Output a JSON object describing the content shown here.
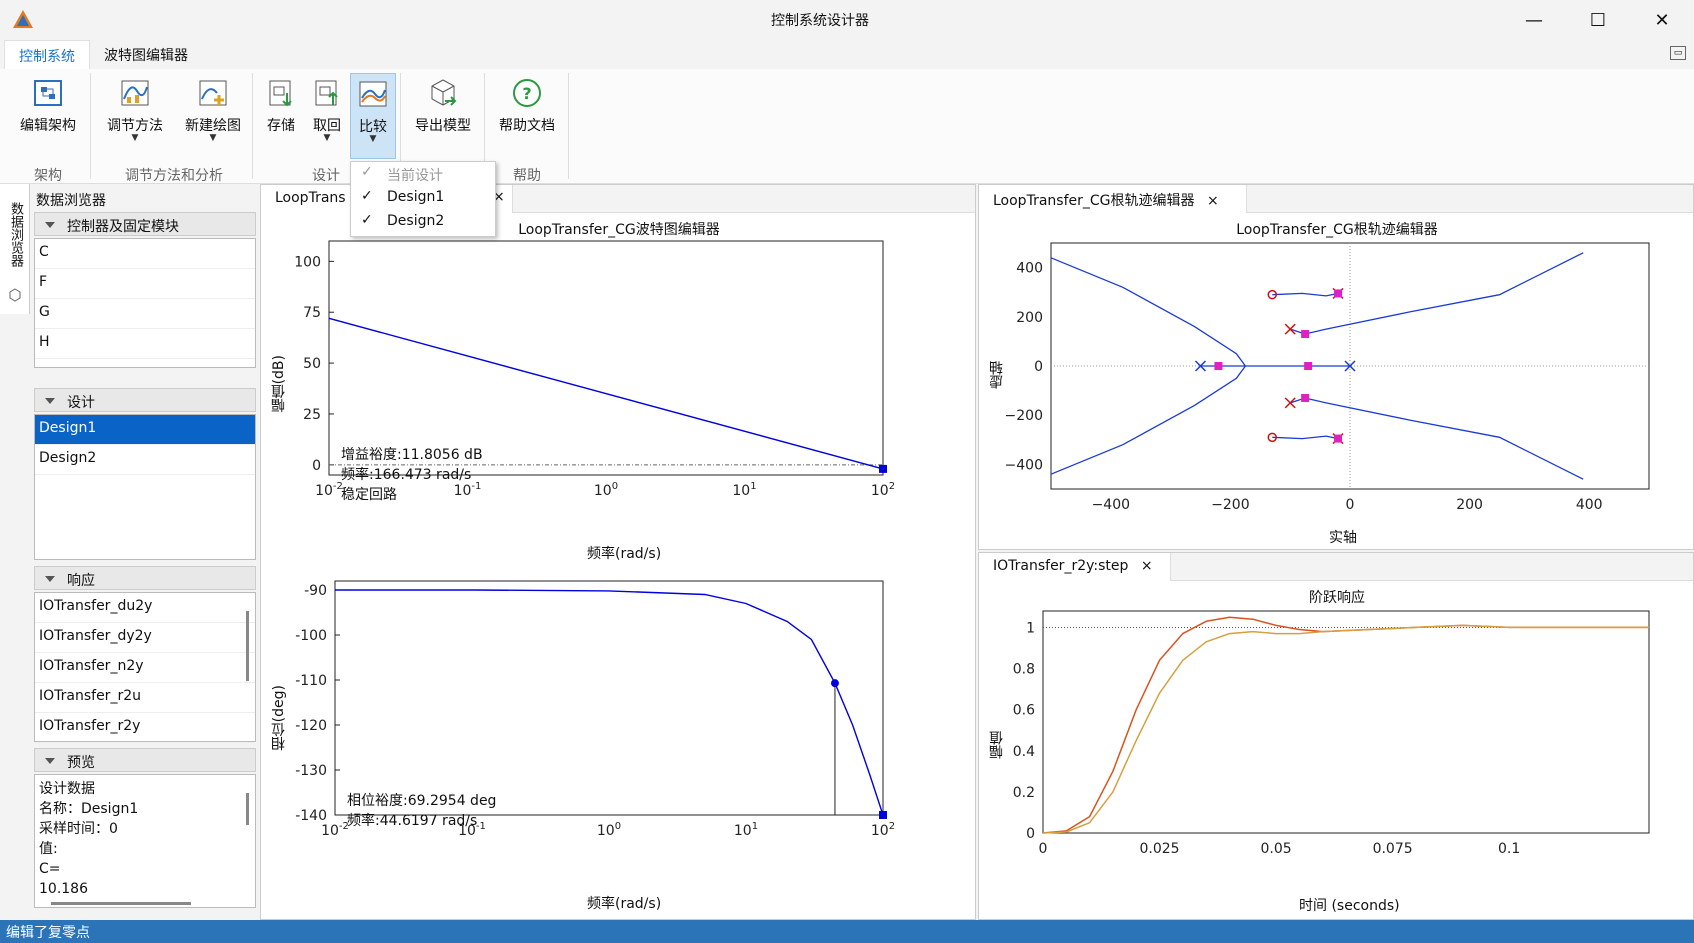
{
  "window": {
    "title": "控制系统设计器"
  },
  "menubar": {
    "tabs": [
      {
        "label": "控制系统"
      },
      {
        "label": "波特图编辑器"
      }
    ]
  },
  "ribbon": {
    "buttons": {
      "edit_arch": "编辑架构",
      "tune": "调节方法",
      "new_plot": "新建绘图",
      "store": "存储",
      "retrieve": "取回",
      "compare": "比较",
      "export": "导出模型",
      "help": "帮助文档"
    },
    "groups": {
      "arch": "架构",
      "tune": "调节方法和分析",
      "design": "设计",
      "help": "帮助"
    }
  },
  "compare_menu": {
    "items": [
      {
        "label": "当前设计",
        "checked": true,
        "disabled": true
      },
      {
        "label": "Design1",
        "checked": true,
        "disabled": false
      },
      {
        "label": "Design2",
        "checked": true,
        "disabled": false
      }
    ]
  },
  "left_strip": {
    "label": "数据浏览器"
  },
  "browser": {
    "title": "数据浏览器",
    "sections": {
      "controllers": "控制器及固定模块",
      "designs": "设计",
      "responses": "响应",
      "preview": "预览"
    },
    "controllers": [
      "C",
      "F",
      "G",
      "H"
    ],
    "designs": [
      "Design1",
      "Design2"
    ],
    "responses": [
      "IOTransfer_du2y",
      "IOTransfer_dy2y",
      "IOTransfer_n2y",
      "IOTransfer_r2u",
      "IOTransfer_r2y"
    ],
    "preview_lines": [
      "设计数据",
      "名称：Design1",
      "采样时间：0",
      "值:",
      "C=",
      "10.186"
    ]
  },
  "bode": {
    "tab": "LoopTransfer_CG波特图编辑器",
    "tab_partial": "LoopTrans",
    "title": "LoopTransfer_CG波特图编辑器",
    "mag_ylabel": "幅值(dB)",
    "phase_ylabel": "相位(deg)",
    "xlabel": "频率(rad/s)",
    "mag_ann": [
      "增益裕度:11.8056 dB",
      "频率:166.473 rad/s",
      "稳定回路"
    ],
    "phase_ann": [
      "相位裕度:69.2954 deg",
      "频率:44.6197 rad/s"
    ]
  },
  "rlocus": {
    "tab": "LoopTransfer_CG根轨迹编辑器",
    "title": "LoopTransfer_CG根轨迹编辑器",
    "xlabel": "实轴",
    "ylabel": "虚轴"
  },
  "step": {
    "tab": "IOTransfer_r2y:step",
    "title": "阶跃响应",
    "xlabel": "时间 (seconds)",
    "ylabel": "幅值"
  },
  "statusbar": {
    "text": "编辑了复零点"
  },
  "chart_data": [
    {
      "type": "line",
      "name": "bode-magnitude",
      "xscale": "log",
      "x": [
        0.01,
        100
      ],
      "values": [
        72,
        -2
      ],
      "xlim": [
        0.01,
        100
      ],
      "ylim": [
        -5,
        110
      ],
      "yticks": [
        0,
        25,
        50,
        75,
        100
      ],
      "xtick_labels": [
        "10-2",
        "10-1",
        "100",
        "101",
        "102"
      ],
      "ylabel": "幅值(dB)",
      "xlabel": "频率(rad/s)",
      "color": "#0000e0"
    },
    {
      "type": "line",
      "name": "bode-phase",
      "xscale": "log",
      "x": [
        0.01,
        0.1,
        1,
        5,
        10,
        20,
        30,
        44.6,
        60,
        80,
        100
      ],
      "values": [
        -90,
        -90,
        -90.2,
        -91,
        -93,
        -97,
        -101,
        -110.7,
        -120,
        -131,
        -140
      ],
      "xlim": [
        0.01,
        100
      ],
      "ylim": [
        -140,
        -88
      ],
      "yticks": [
        -90,
        -100,
        -110,
        -120,
        -130,
        -140
      ],
      "xtick_labels": [
        "10-2",
        "10-1",
        "100",
        "101",
        "102"
      ],
      "ylabel": "相位(deg)",
      "xlabel": "频率(rad/s)",
      "color": "#0000e0"
    },
    {
      "type": "scatter",
      "name": "root-locus",
      "xlim": [
        -500,
        500
      ],
      "ylim": [
        -500,
        500
      ],
      "xticks": [
        -400,
        -200,
        0,
        200,
        400
      ],
      "yticks": [
        -400,
        -200,
        0,
        200,
        400
      ],
      "xlabel": "实轴",
      "ylabel": "虚轴",
      "poles": [
        [
          -250,
          0
        ],
        [
          0,
          0
        ],
        [
          -100,
          150
        ],
        [
          -100,
          -150
        ],
        [
          -20,
          295
        ],
        [
          -20,
          -295
        ]
      ],
      "zeros": [
        [
          -130,
          290
        ],
        [
          -130,
          -290
        ]
      ],
      "closed_loop": [
        [
          -220,
          0
        ],
        [
          -70,
          0
        ],
        [
          -75,
          130
        ],
        [
          -75,
          -130
        ],
        [
          -20,
          295
        ],
        [
          -20,
          -295
        ]
      ]
    },
    {
      "type": "line",
      "name": "step-response",
      "xlim": [
        0,
        0.13
      ],
      "ylim": [
        0,
        1.08
      ],
      "xticks": [
        0,
        0.025,
        0.05,
        0.075,
        0.1
      ],
      "yticks": [
        0,
        0.2,
        0.4,
        0.6,
        0.8,
        1
      ],
      "xlabel": "时间 (seconds)",
      "ylabel": "幅值",
      "series": [
        {
          "x": [
            0,
            0.005,
            0.01,
            0.015,
            0.02,
            0.025,
            0.03,
            0.035,
            0.04,
            0.045,
            0.05,
            0.055,
            0.06,
            0.07,
            0.08,
            0.09,
            0.1,
            0.11,
            0.12,
            0.13
          ],
          "values": [
            0,
            0.01,
            0.08,
            0.3,
            0.6,
            0.84,
            0.97,
            1.03,
            1.05,
            1.04,
            1.01,
            0.99,
            0.98,
            0.99,
            1.0,
            1.01,
            1.0,
            1.0,
            1.0,
            1.0
          ],
          "color": "#d9541f"
        },
        {
          "x": [
            0,
            0.005,
            0.01,
            0.015,
            0.02,
            0.025,
            0.03,
            0.035,
            0.04,
            0.045,
            0.05,
            0.055,
            0.06,
            0.07,
            0.08,
            0.09,
            0.1,
            0.11,
            0.12,
            0.13
          ],
          "values": [
            0,
            0.005,
            0.05,
            0.2,
            0.45,
            0.68,
            0.84,
            0.93,
            0.97,
            0.98,
            0.97,
            0.97,
            0.98,
            0.99,
            1.0,
            1.01,
            1.0,
            1.0,
            1.0,
            1.0
          ],
          "color": "#d5a040"
        }
      ]
    }
  ]
}
